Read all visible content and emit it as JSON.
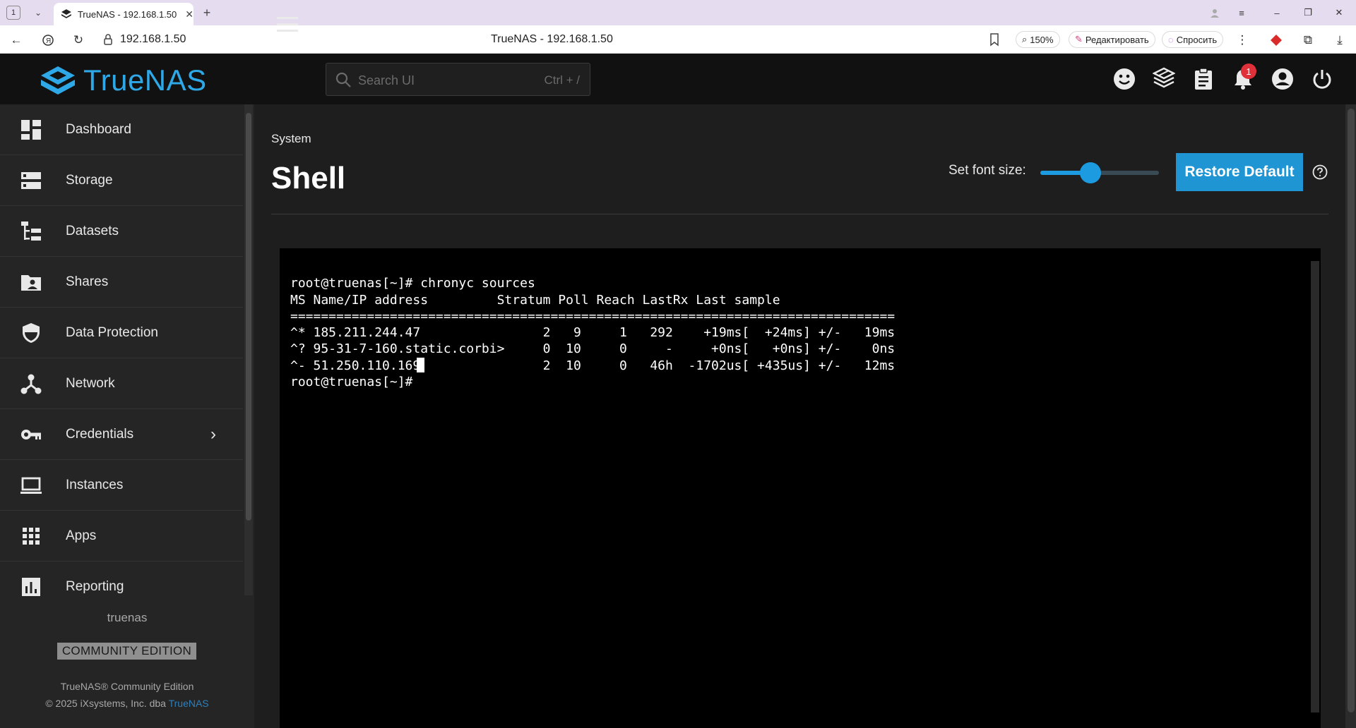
{
  "browser": {
    "tab_count": "1",
    "tab_title": "TrueNAS - 192.168.1.50",
    "url": "192.168.1.50",
    "page_title": "TrueNAS - 192.168.1.50",
    "zoom": "150%",
    "edit_label": "Редактировать",
    "ask_label": "Спросить"
  },
  "header": {
    "logo_text": "TrueNAS",
    "search_placeholder": "Search UI",
    "search_shortcut": "Ctrl + /",
    "notification_count": "1"
  },
  "sidebar": {
    "items": [
      {
        "label": "Dashboard",
        "icon": "dashboard-icon"
      },
      {
        "label": "Storage",
        "icon": "storage-icon"
      },
      {
        "label": "Datasets",
        "icon": "datasets-icon"
      },
      {
        "label": "Shares",
        "icon": "shares-icon"
      },
      {
        "label": "Data Protection",
        "icon": "shield-icon"
      },
      {
        "label": "Network",
        "icon": "network-icon"
      },
      {
        "label": "Credentials",
        "icon": "key-icon"
      },
      {
        "label": "Instances",
        "icon": "laptop-icon"
      },
      {
        "label": "Apps",
        "icon": "apps-grid-icon"
      },
      {
        "label": "Reporting",
        "icon": "chart-icon"
      }
    ],
    "hostname": "truenas",
    "edition": "COMMUNITY EDITION",
    "copyright_line1": "TrueNAS® Community Edition",
    "copyright_line2": "© 2025 iXsystems, Inc. dba",
    "copyright_link": "TrueNAS"
  },
  "main": {
    "breadcrumb": "System",
    "title": "Shell",
    "font_size_label": "Set font size:",
    "font_size_level": 0.42,
    "restore_button": "Restore Default"
  },
  "terminal": {
    "lines": [
      "root@truenas[~]# chronyc sources",
      "MS Name/IP address         Stratum Poll Reach LastRx Last sample",
      "===============================================================================",
      "^* 185.211.244.47                2   9     1   292    +19ms[  +24ms] +/-   19ms",
      "^? 95-31-7-160.static.corbi>     0  10     0     -     +0ns[   +0ns] +/-    0ns",
      "^- 51.250.110.169                2  10     0   46h  -1702us[ +435us] +/-   12ms",
      "root@truenas[~]# "
    ]
  },
  "colors": {
    "accent": "#1f95d4",
    "logo": "#2ea8e6",
    "header_bg": "#111111",
    "sidebar_bg": "#252525",
    "terminal_bg": "#000000",
    "badge": "#e0303a"
  }
}
